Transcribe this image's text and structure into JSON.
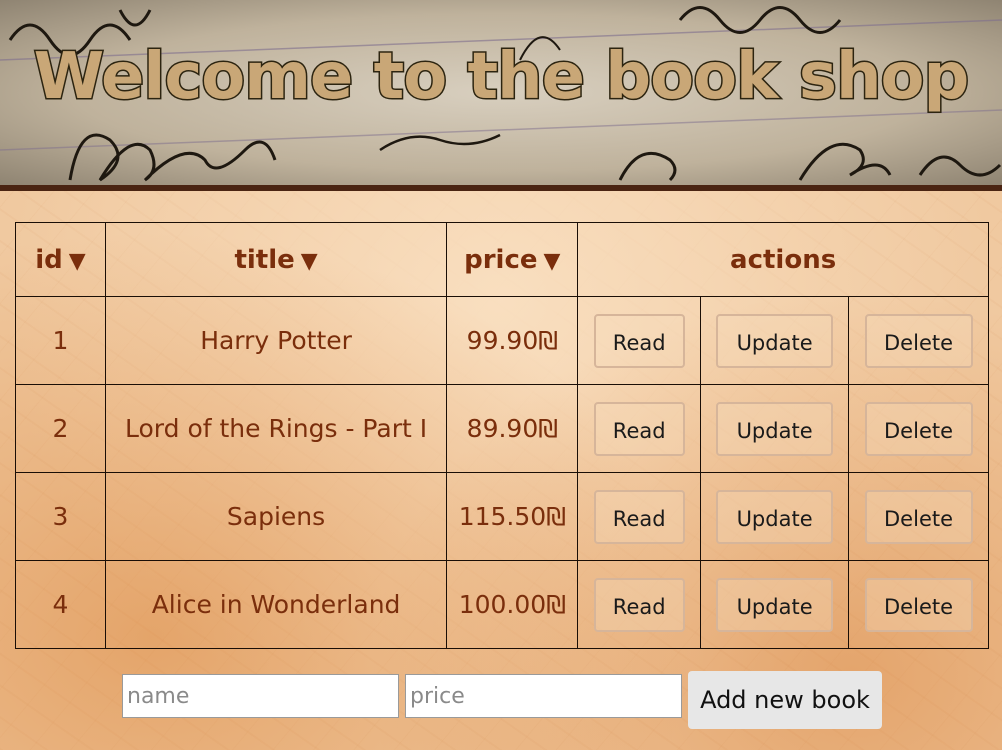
{
  "header": {
    "title": "Welcome to the book shop"
  },
  "table": {
    "columns": [
      {
        "label": "id",
        "sort_indicator": "▼"
      },
      {
        "label": "title",
        "sort_indicator": "▼"
      },
      {
        "label": "price",
        "sort_indicator": "▼"
      },
      {
        "label": "actions"
      }
    ],
    "rows": [
      {
        "id": "1",
        "title": "Harry Potter",
        "price": "99.90₪"
      },
      {
        "id": "2",
        "title": "Lord of the Rings - Part I",
        "price": "89.90₪"
      },
      {
        "id": "3",
        "title": "Sapiens",
        "price": "115.50₪"
      },
      {
        "id": "4",
        "title": "Alice in Wonderland",
        "price": "100.00₪"
      }
    ],
    "actions": {
      "read_label": "Read",
      "update_label": "Update",
      "delete_label": "Delete"
    }
  },
  "add_form": {
    "name_placeholder": "name",
    "name_value": "",
    "price_placeholder": "price",
    "price_value": "",
    "add_button_label": "Add new book"
  },
  "colors": {
    "text_brown": "#7a2e0c",
    "header_border": "#4a2412",
    "title_fill": "#c9a777",
    "title_stroke": "#2c2410"
  }
}
